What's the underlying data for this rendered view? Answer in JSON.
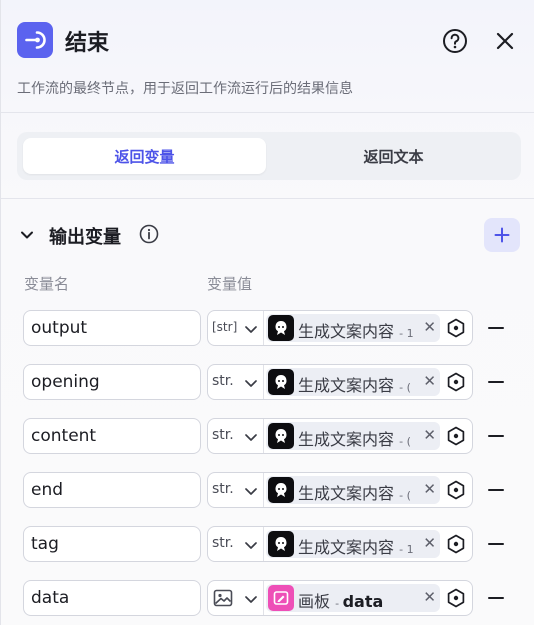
{
  "header": {
    "title": "结束",
    "icon": "exit-node-icon"
  },
  "description": "工作流的最终节点，用于返回工作流运行后的结果信息",
  "tabs": [
    {
      "label": "返回变量",
      "active": true
    },
    {
      "label": "返回文本",
      "active": false
    }
  ],
  "section": {
    "title": "输出变量"
  },
  "columns": {
    "name": "变量名",
    "value": "变量值"
  },
  "rows": [
    {
      "name": "output",
      "type": "[str]",
      "ref_label": "生成文案内容",
      "ref_suffix": "- 1"
    },
    {
      "name": "opening",
      "type": "str.",
      "ref_label": "生成文案内容",
      "ref_suffix": "- ("
    },
    {
      "name": "content",
      "type": "str.",
      "ref_label": "生成文案内容",
      "ref_suffix": "- ("
    },
    {
      "name": "end",
      "type": "str.",
      "ref_label": "生成文案内容",
      "ref_suffix": "- ("
    },
    {
      "name": "tag",
      "type": "str.",
      "ref_label": "生成文案内容",
      "ref_suffix": "- 1"
    },
    {
      "name": "data",
      "type": "image-icon",
      "ref_label": "画板",
      "ref_suffix": "- ",
      "ref_var": "data"
    }
  ],
  "colors": {
    "accent": "#4d53e8",
    "node_icon": "#5b63ef",
    "pink": "#ee4fb7"
  }
}
